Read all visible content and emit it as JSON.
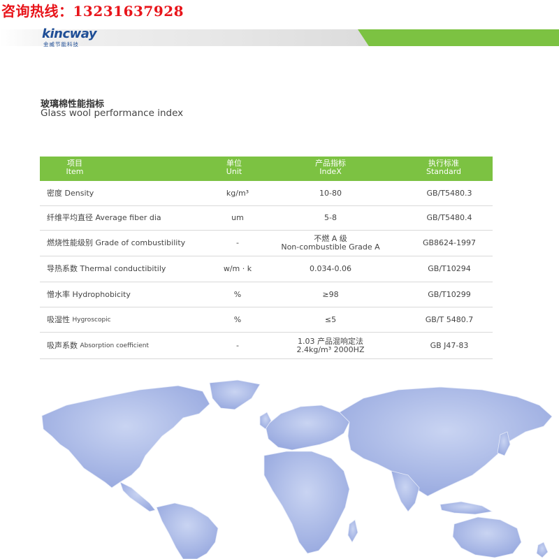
{
  "hotline": "咨询热线：13231637928",
  "brand": {
    "name": "kincway",
    "subtitle": "金威节能科技"
  },
  "colors": {
    "accent": "#7cc242",
    "hotline": "#e8141a",
    "brand": "#1f4e96",
    "map": "#a7b7e3"
  },
  "title": {
    "cn": "玻璃棉性能指标",
    "en": "Glass wool performance index"
  },
  "table": {
    "headers": [
      {
        "cn": "项目",
        "en": "Item"
      },
      {
        "cn": "单位",
        "en": "Unit"
      },
      {
        "cn": "产品指标",
        "en": "IndeX"
      },
      {
        "cn": "执行标准",
        "en": "Standard"
      }
    ],
    "rows": [
      {
        "item_cn": "密度",
        "item_en": "Density",
        "unit": "kg/m³",
        "index": "10-80",
        "index2": "",
        "standard": "GB/T5480.3"
      },
      {
        "item_cn": "纤维平均直径",
        "item_en": "Average fiber dia",
        "unit": "um",
        "index": "5-8",
        "index2": "",
        "standard": "GB/T5480.4"
      },
      {
        "item_cn": "燃烧性能级别",
        "item_en": "Grade of combustibility",
        "unit": "-",
        "index": "不燃 A 级",
        "index2": "Non-combustible Grade A",
        "standard": "GB8624-1997"
      },
      {
        "item_cn": "导热系数",
        "item_en": "Thermal conductibitily",
        "unit": "w/m · k",
        "index": "0.034-0.06",
        "index2": "",
        "standard": "GB/T10294"
      },
      {
        "item_cn": "憎水率",
        "item_en": "Hydrophobicity",
        "unit": "%",
        "index": "≥98",
        "index2": "",
        "standard": "GB/T10299"
      },
      {
        "item_cn": "吸湿性",
        "item_en": "Hygroscopic",
        "unit": "%",
        "index": "≤5",
        "index2": "",
        "standard": "GB/T 5480.7"
      },
      {
        "item_cn": "吸声系数",
        "item_en": "Absorption coefficient",
        "unit": "-",
        "index": "1.03 产品混响定法",
        "index2": "2.4kg/m³ 2000HZ",
        "standard": "GB J47-83"
      }
    ]
  }
}
